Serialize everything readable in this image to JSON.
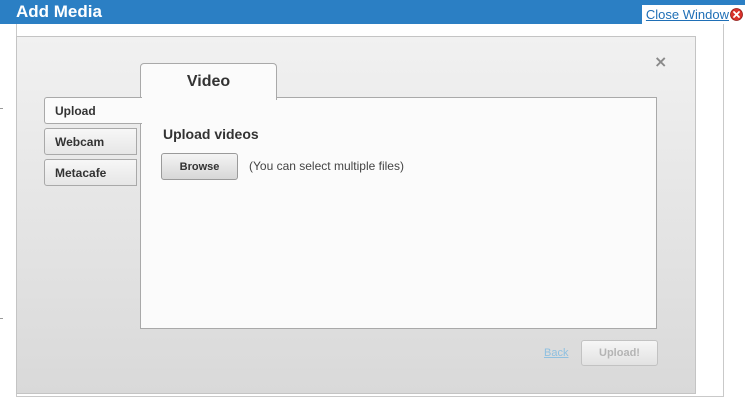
{
  "window": {
    "title": "Add Media",
    "close_window_label": "Close Window",
    "close_icon": "close-circle-icon",
    "dismiss_glyph": "×"
  },
  "tabs": {
    "main_tab_label": "Video",
    "side_tabs": [
      {
        "label": "Upload",
        "active": true
      },
      {
        "label": "Webcam",
        "active": false
      },
      {
        "label": "Metacafe",
        "active": false
      }
    ]
  },
  "upload": {
    "heading": "Upload videos",
    "browse_label": "Browse",
    "hint": "(You can select multiple files)"
  },
  "footer": {
    "back_label": "Back",
    "upload_label": "Upload!"
  },
  "colors": {
    "title_bar": "#2b7fc4",
    "link": "#1f6fb6",
    "close_icon_red": "#d9312b"
  }
}
